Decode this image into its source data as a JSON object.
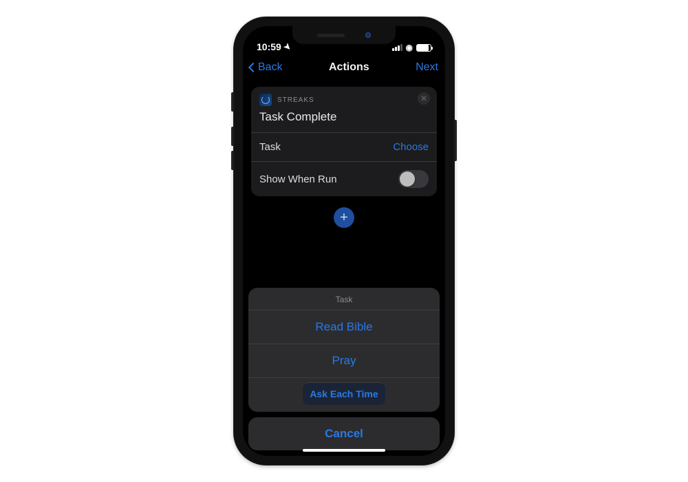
{
  "status": {
    "time": "10:59"
  },
  "nav": {
    "back": "Back",
    "title": "Actions",
    "next": "Next"
  },
  "action": {
    "app_name": "STREAKS",
    "title": "Task Complete",
    "task_label": "Task",
    "task_value": "Choose",
    "show_when_run_label": "Show When Run",
    "show_when_run_on": false
  },
  "sheet": {
    "header": "Task",
    "options": [
      "Read Bible",
      "Pray"
    ],
    "ask_each_time": "Ask Each Time",
    "cancel": "Cancel"
  }
}
